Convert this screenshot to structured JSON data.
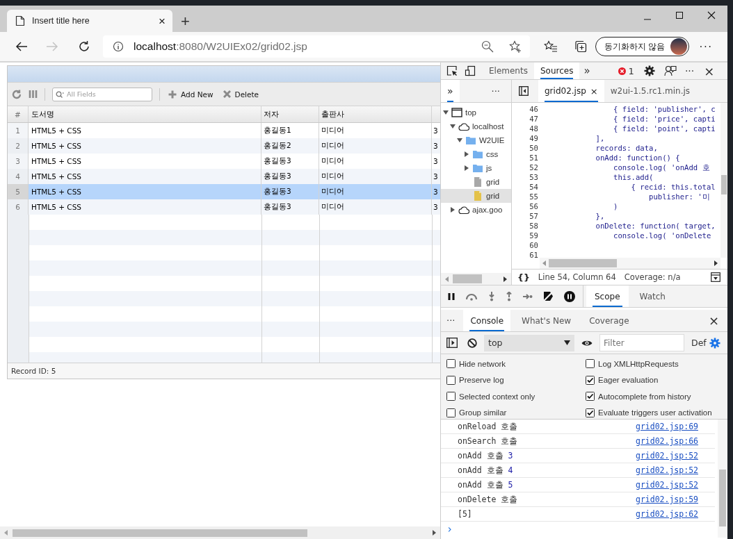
{
  "browser": {
    "tabs": [
      {
        "title": "Insert title here",
        "close": "×",
        "selected": true
      }
    ],
    "new_tab": "+",
    "back": {
      "disabled": false
    },
    "forward": {
      "disabled": true
    },
    "url": {
      "host": "localhost",
      "path": ":8080/W2UIEx02/grid02.jsp"
    },
    "profile": {
      "label": "동기화하지 않음"
    },
    "menu": "···"
  },
  "grid": {
    "search": {
      "placeholder": "All Fields"
    },
    "toolbar": [
      {
        "label": "Add New",
        "kind": "add"
      },
      {
        "label": "Delete",
        "kind": "delete"
      }
    ],
    "columns": [
      "#",
      "도서명",
      "저자",
      "출판사"
    ],
    "rows": [
      {
        "number": "1",
        "title": "HTML5 + CSS",
        "author": "홍길동1",
        "publisher": "미디어",
        "column_5": "3",
        "selected": false
      },
      {
        "number": "2",
        "title": "HTML5 + CSS",
        "author": "홍길동2",
        "publisher": "미디어",
        "column_5": "3",
        "selected": false
      },
      {
        "number": "3",
        "title": "HTML5 + CSS",
        "author": "홍길동3",
        "publisher": "미디어",
        "column_5": "3",
        "selected": false
      },
      {
        "number": "4",
        "title": "HTML5 + CSS",
        "author": "홍길동3",
        "publisher": "미디어",
        "column_5": "3",
        "selected": false
      },
      {
        "number": "5",
        "title": "HTML5 + CSS",
        "author": "홍길동3",
        "publisher": "미디어",
        "column_5": "3",
        "selected": true
      },
      {
        "number": "6",
        "title": "HTML5 + CSS",
        "author": "홍길동3",
        "publisher": "미디어",
        "column_5": "3",
        "selected": false
      }
    ],
    "footer": "Record ID: 5"
  },
  "devtools": {
    "tabs": [
      {
        "label": "Elements",
        "selected": false
      },
      {
        "label": "Sources",
        "selected": true
      }
    ],
    "more_tabs": "»",
    "errors": "1",
    "more": "···",
    "close": "×",
    "navigator": {
      "tabs": [
        {
          "label": "»",
          "selected": true
        }
      ],
      "more": "···",
      "tree": [
        {
          "label": "top",
          "kind": "frame",
          "expanded": true,
          "selected": false,
          "children": [
            {
              "label": "localhost",
              "kind": "origin",
              "expanded": true,
              "selected": false,
              "children": [
                {
                  "label": "W2UIE",
                  "kind": "folder",
                  "expanded": true,
                  "selected": false,
                  "children": [
                    {
                      "label": "css",
                      "kind": "folder",
                      "expanded": false,
                      "selected": false
                    },
                    {
                      "label": "js",
                      "kind": "folder",
                      "expanded": false,
                      "selected": false
                    },
                    {
                      "label": "grid",
                      "kind": "file",
                      "selected": false
                    },
                    {
                      "label": "grid",
                      "kind": "script",
                      "selected": true
                    }
                  ]
                }
              ]
            },
            {
              "label": "ajax.goo",
              "kind": "origin",
              "expanded": false,
              "selected": false
            }
          ]
        }
      ]
    },
    "editor": {
      "tabs": [
        {
          "label": "grid02.jsp",
          "close": "×",
          "selected": true
        },
        {
          "label": "w2ui-1.5.rc1.min.js",
          "selected": false
        }
      ],
      "lines": [
        {
          "number": "46",
          "code": "                { field: 'publisher', c"
        },
        {
          "number": "47",
          "code": "                { field: 'price', capti"
        },
        {
          "number": "48",
          "code": "                { field: 'point', capti"
        },
        {
          "number": "49",
          "code": "            ],"
        },
        {
          "number": "50",
          "code": "            records: data,"
        },
        {
          "number": "51",
          "code": "            onAdd: function() {"
        },
        {
          "number": "52",
          "code": "                console.log( 'onAdd 호"
        },
        {
          "number": "53",
          "code": "                this.add("
        },
        {
          "number": "54",
          "code": "                    { recid: this.total"
        },
        {
          "number": "55",
          "code": "                        publisher: '미"
        },
        {
          "number": "56",
          "code": "                )"
        },
        {
          "number": "57",
          "code": "            },"
        },
        {
          "number": "58",
          "code": "            onDelete: function( target,"
        },
        {
          "number": "59",
          "code": "                console.log( 'onDelete"
        },
        {
          "number": "60"
        },
        {
          "number": "61"
        }
      ],
      "status": {
        "braces": "{}",
        "position": "Line 54, Column 64",
        "coverage": "Coverage: n/a"
      }
    },
    "debugger": {
      "tabs": [
        {
          "label": "Scope",
          "selected": true
        },
        {
          "label": "Watch",
          "selected": false
        }
      ]
    },
    "drawer": {
      "more": "···",
      "tabs": [
        {
          "label": "Console",
          "selected": true
        },
        {
          "label": "What's New",
          "selected": false
        },
        {
          "label": "Coverage",
          "selected": false
        }
      ],
      "close": "×"
    },
    "console": {
      "context": "top",
      "filter": {
        "placeholder": "Filter"
      },
      "levels": "Def",
      "settings": [
        {
          "label": "Hide network",
          "checked": false
        },
        {
          "label": "Log XMLHttpRequests",
          "checked": false
        },
        {
          "label": "Preserve log",
          "checked": false
        },
        {
          "label": "Eager evaluation",
          "checked": true
        },
        {
          "label": "Selected context only",
          "checked": false
        },
        {
          "label": "Autocomplete from history",
          "checked": true
        },
        {
          "label": "Group similar",
          "checked": false
        },
        {
          "label": "Evaluate triggers user activation",
          "checked": true
        }
      ],
      "messages": [
        {
          "text": "onReload 호출",
          "source": "grid02.jsp:69"
        },
        {
          "text": "onSearch 호출",
          "source": "grid02.jsp:66"
        },
        {
          "text": "onAdd 호출",
          "arg": "3",
          "source": "grid02.jsp:52"
        },
        {
          "text": "onAdd 호출",
          "arg": "4",
          "source": "grid02.jsp:52"
        },
        {
          "text": "onAdd 호출",
          "arg": "5",
          "source": "grid02.jsp:52"
        },
        {
          "text": "onDelete 호출",
          "source": "grid02.jsp:59"
        },
        {
          "text": "[5]",
          "source": "grid02.jsp:62"
        }
      ],
      "prompt": "›"
    }
  }
}
